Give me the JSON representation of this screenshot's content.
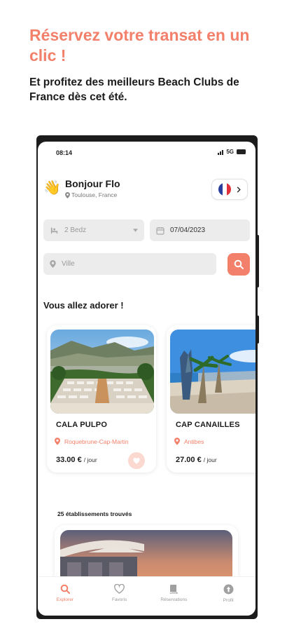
{
  "promo": {
    "headline": "Réservez votre transat en un clic !",
    "subline": "Et profitez des meilleurs Beach Clubs de France dès cet été."
  },
  "status_bar": {
    "time": "08:14",
    "network": "5G"
  },
  "header": {
    "greeting": "Bonjour Flo",
    "location": "Toulouse, France",
    "language_flag": "france-flag-icon"
  },
  "search": {
    "beds_value": "2 Bedz",
    "date_value": "07/04/2023",
    "city_placeholder": "Ville"
  },
  "section_title": "Vous allez adorer !",
  "cards": [
    {
      "name": "CALA PULPO",
      "location": "Roquebrune-Cap-Martin",
      "price": "33.00 €",
      "unit": "/ jour"
    },
    {
      "name": "CAP CANAILLES",
      "location": "Antibes",
      "price": "27.00 €",
      "unit": "/ jour"
    }
  ],
  "results_count": "25 établissements trouvés",
  "tabs": [
    {
      "label": "Explorer",
      "icon": "search-icon",
      "active": true
    },
    {
      "label": "Favoris",
      "icon": "heart-icon",
      "active": false
    },
    {
      "label": "Réservations",
      "icon": "book-icon",
      "active": false
    },
    {
      "label": "Profil",
      "icon": "profile-icon",
      "active": false
    }
  ],
  "colors": {
    "accent": "#f2806a",
    "text": "#1b1b1b",
    "field_bg": "#ececec"
  }
}
